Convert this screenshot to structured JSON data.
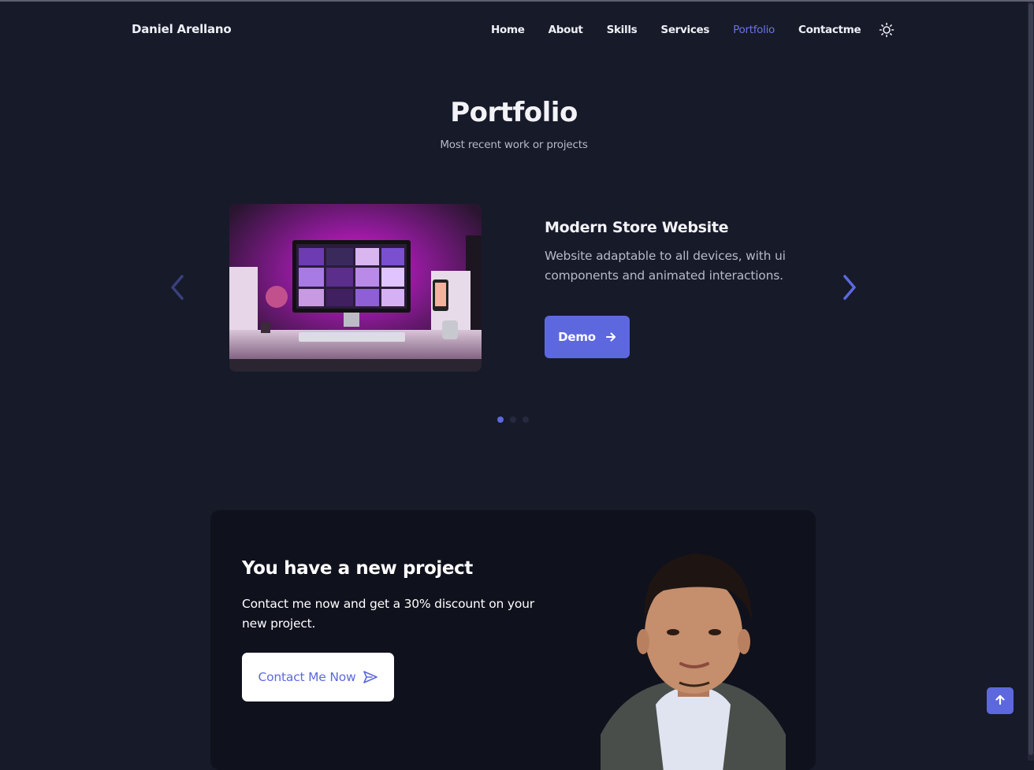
{
  "header": {
    "brand": "Daniel Arellano",
    "nav": [
      {
        "label": "Home",
        "active": false
      },
      {
        "label": "About",
        "active": false
      },
      {
        "label": "Skills",
        "active": false
      },
      {
        "label": "Services",
        "active": false
      },
      {
        "label": "Portfolio",
        "active": true
      },
      {
        "label": "Contactme",
        "active": false
      }
    ],
    "theme_icon": "sun-icon"
  },
  "portfolio": {
    "title": "Portfolio",
    "subtitle": "Most recent work or projects",
    "slide": {
      "title": "Modern Store Website",
      "description": "Website adaptable to all devices, with ui components and animated interactions.",
      "button_label": "Demo",
      "image_icon": "desktop-setup-photo"
    },
    "slides_count": 3,
    "active_slide": 1
  },
  "cta": {
    "title": "You have a new project",
    "text": "Contact me now and get a 30% discount on your new project.",
    "button_label": "Contact Me Now"
  },
  "colors": {
    "background": "#171a29",
    "card": "#0f111d",
    "accent": "#5d68df",
    "text": "#f2f2f7",
    "muted": "#b6b9c8"
  }
}
